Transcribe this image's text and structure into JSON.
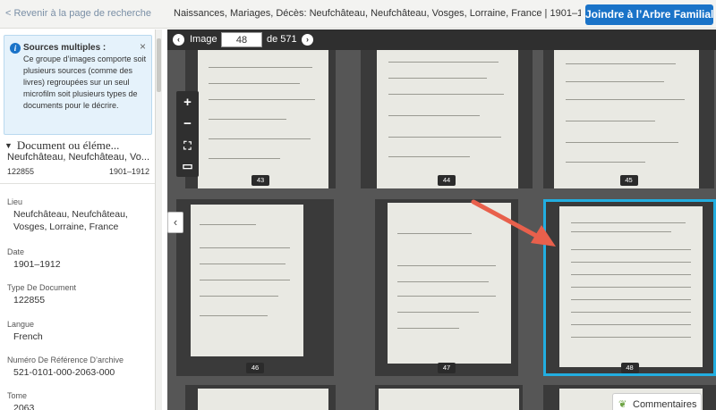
{
  "header": {
    "back_link": "< Revenir à la page de recherche",
    "title": "Naissances, Mariages, Décès: Neufchâteau, Neufchâteau, Vosges, Lorraine, France | 1901–19...",
    "join_button": "Joindre à l’Arbre Familial"
  },
  "info": {
    "title": "Sources multiples :",
    "text": "Ce groupe d’images comporte soit plusieurs sources (comme des livres) regroupées sur un seul microfilm soit plusieurs types de documents pour le décrire.",
    "close": "×"
  },
  "document": {
    "header": "Document ou éléme...",
    "place": "Neufchâteau, Neufchâteau, Vo...",
    "number": "122855",
    "years": "1901–1912"
  },
  "metadata": [
    {
      "label": "Lieu",
      "value": "Neufchâteau, Neufchâteau, Vosges, Lorraine, France"
    },
    {
      "label": "Date",
      "value": "1901–1912"
    },
    {
      "label": "Type De Document",
      "value": "122855"
    },
    {
      "label": "Langue",
      "value": "French"
    },
    {
      "label": "Numéro De Référence D’archive",
      "value": "521-0101-000-2063-000"
    },
    {
      "label": "Tome",
      "value": "2063"
    }
  ],
  "viewer": {
    "image_label": "Image",
    "current_image": "48",
    "total_label": "de 571",
    "prev_icon": "‹",
    "next_icon": "›",
    "zoom_in": "+",
    "zoom_out": "−",
    "fullscreen": "⛶",
    "fit": "▭",
    "collapse_icon": "‹",
    "thumbnails": [
      "43",
      "44",
      "45",
      "46",
      "47",
      "48"
    ],
    "selected_thumbnail": "48"
  },
  "comments": {
    "label": "Commentaires"
  },
  "colors": {
    "accent": "#1a73c8",
    "selection": "#22aee0",
    "arrow": "#e8604c"
  }
}
